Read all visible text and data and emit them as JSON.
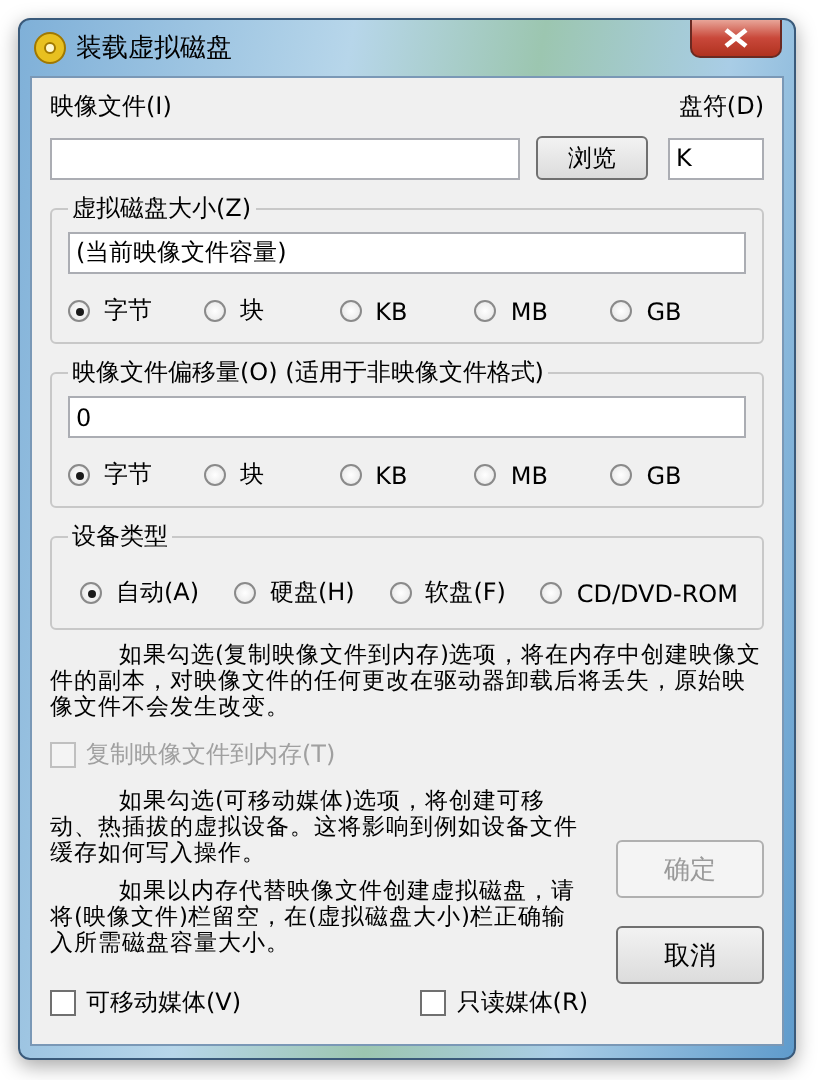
{
  "window": {
    "title": "装载虚拟磁盘"
  },
  "image_file": {
    "label": "映像文件(I)"
  },
  "browse_button": {
    "label": "浏览"
  },
  "drive_letter": {
    "label": "盘符(D)",
    "value": "K"
  },
  "size_group": {
    "title": "虚拟磁盘大小(Z)",
    "value": "(当前映像文件容量)",
    "units": [
      {
        "label": "字节",
        "selected": true
      },
      {
        "label": "块",
        "selected": false
      },
      {
        "label": "KB",
        "selected": false
      },
      {
        "label": "MB",
        "selected": false
      },
      {
        "label": "GB",
        "selected": false
      }
    ]
  },
  "offset_group": {
    "title": "映像文件偏移量(O) (适用于非映像文件格式)",
    "value": "0",
    "units": [
      {
        "label": "字节",
        "selected": true
      },
      {
        "label": "块",
        "selected": false
      },
      {
        "label": "KB",
        "selected": false
      },
      {
        "label": "MB",
        "selected": false
      },
      {
        "label": "GB",
        "selected": false
      }
    ]
  },
  "device_group": {
    "title": "设备类型",
    "types": [
      {
        "label": "自动(A)",
        "selected": true
      },
      {
        "label": "硬盘(H)",
        "selected": false
      },
      {
        "label": "软盘(F)",
        "selected": false
      },
      {
        "label": "CD/DVD-ROM",
        "selected": false
      }
    ]
  },
  "copy_note": "如果勾选(复制映像文件到内存)选项，将在内存中创建映像文件的副本，对映像文件的任何更改在驱动器卸载后将丢失，原始映像文件不会发生改变。",
  "copy_checkbox": {
    "label": "复制映像文件到内存(T)",
    "checked": false,
    "disabled": true
  },
  "removable_note": "如果勾选(可移动媒体)选项，将创建可移动、热插拔的虚拟设备。这将影响到例如设备文件缓存如何写入操作。",
  "memory_note": "如果以内存代替映像文件创建虚拟磁盘，请将(映像文件)栏留空，在(虚拟磁盘大小)栏正确输入所需磁盘容量大小。",
  "bottom_checkboxes": [
    {
      "label": "可移动媒体(V)",
      "checked": false,
      "disabled": false
    },
    {
      "label": "只读媒体(R)",
      "checked": false,
      "disabled": false
    }
  ],
  "buttons": [
    {
      "label": "确定",
      "disabled": true
    },
    {
      "label": "取消",
      "disabled": false
    }
  ]
}
